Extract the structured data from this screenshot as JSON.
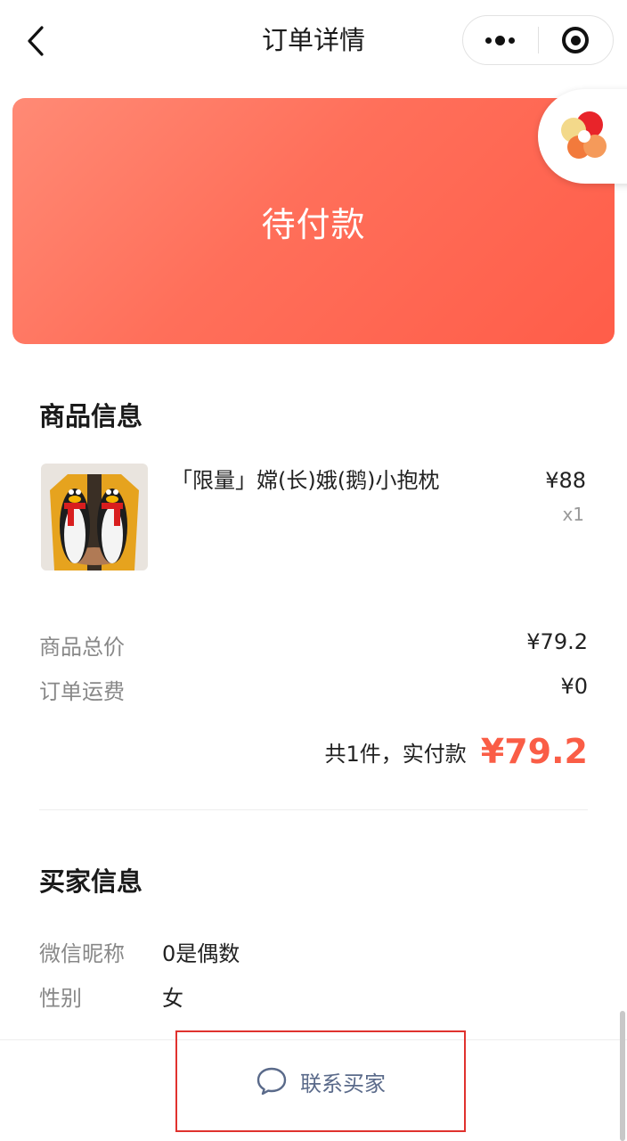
{
  "nav": {
    "title": "订单详情",
    "back_icon": "chevron-left-icon",
    "more_icon": "more-dots-icon",
    "close_icon": "target-circle-icon"
  },
  "status": {
    "text": "待付款",
    "gradient_colors": [
      "#ff8a75",
      "#ff5d49"
    ]
  },
  "floating_logo": {
    "icon": "flower-logo-icon"
  },
  "product_section": {
    "title": "商品信息",
    "item": {
      "name": "「限量」嫦(长)娥(鹅)小抱枕",
      "price": "¥88",
      "quantity": "x1",
      "thumbnail_icon": "penguin-plush-photo"
    }
  },
  "summary": {
    "rows": [
      {
        "label": "商品总价",
        "value": "¥79.2"
      },
      {
        "label": "订单运费",
        "value": "¥0"
      }
    ],
    "total_label": "共1件，实付款",
    "total_amount": "¥79.2",
    "total_color": "#fa5d46"
  },
  "buyer_section": {
    "title": "买家信息",
    "fields": [
      {
        "label": "微信昵称",
        "value": "0是偶数"
      },
      {
        "label": "性别",
        "value": "女"
      }
    ]
  },
  "bottom": {
    "contact_label": "联系买家",
    "contact_icon": "chat-bubble-icon",
    "highlight_color": "#e0322e"
  }
}
